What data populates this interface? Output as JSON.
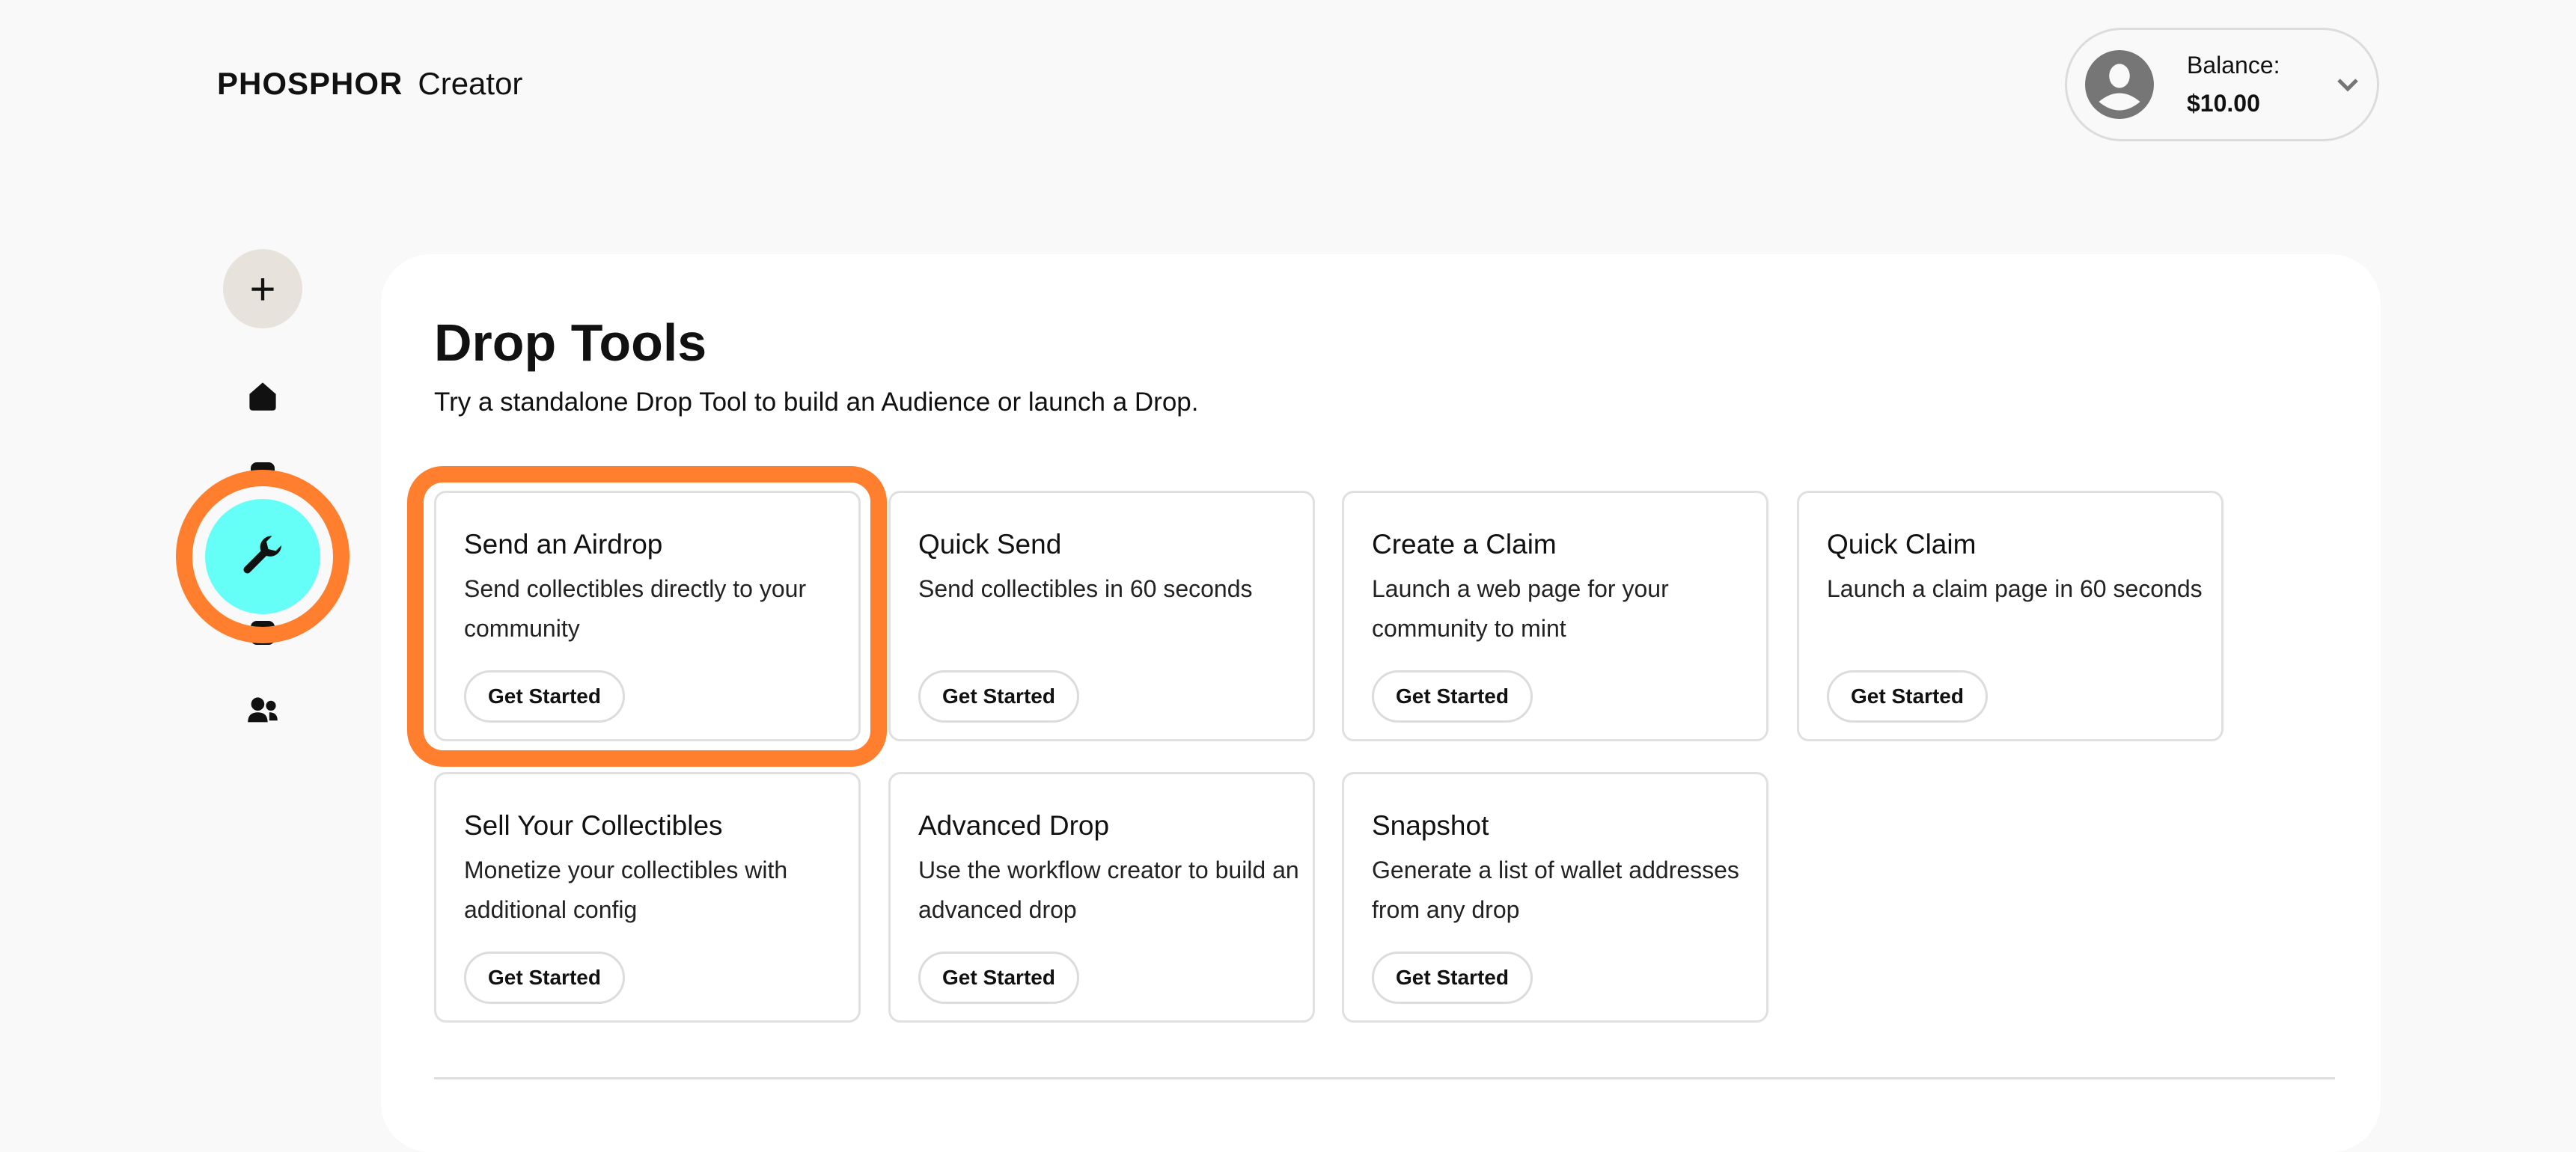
{
  "header": {
    "brand": "PHOSPHOR",
    "product": "Creator",
    "balance_label": "Balance:",
    "balance_value": "$10.00"
  },
  "sidebar": {
    "items": [
      {
        "icon": "plus-icon",
        "label": "+"
      },
      {
        "icon": "home-icon"
      },
      {
        "icon": "collection-icon"
      },
      {
        "icon": "wrench-icon",
        "active": true
      },
      {
        "icon": "folder-icon"
      },
      {
        "icon": "people-icon"
      }
    ]
  },
  "colors": {
    "accent": "#66fff8",
    "highlight": "#ff7f2f",
    "plus_bg": "#e8e2dc"
  },
  "main": {
    "title": "Drop Tools",
    "subtitle": "Try a standalone Drop Tool to build an Audience or launch a Drop.",
    "cards": [
      {
        "title": "Send an Airdrop",
        "desc": "Send collectibles directly to your community",
        "button": "Get Started"
      },
      {
        "title": "Quick Send",
        "desc": "Send collectibles in 60 seconds",
        "button": "Get Started"
      },
      {
        "title": "Create a Claim",
        "desc": "Launch a web page for your community to mint",
        "button": "Get Started"
      },
      {
        "title": "Quick Claim",
        "desc": "Launch a claim page in 60 seconds",
        "button": "Get Started"
      },
      {
        "title": "Sell Your Collectibles",
        "desc": "Monetize your collectibles with additional config",
        "button": "Get Started"
      },
      {
        "title": "Advanced Drop",
        "desc": "Use the workflow creator to build an advanced drop",
        "button": "Get Started"
      },
      {
        "title": "Snapshot",
        "desc": "Generate a list of wallet addresses from any drop",
        "button": "Get Started"
      }
    ]
  }
}
